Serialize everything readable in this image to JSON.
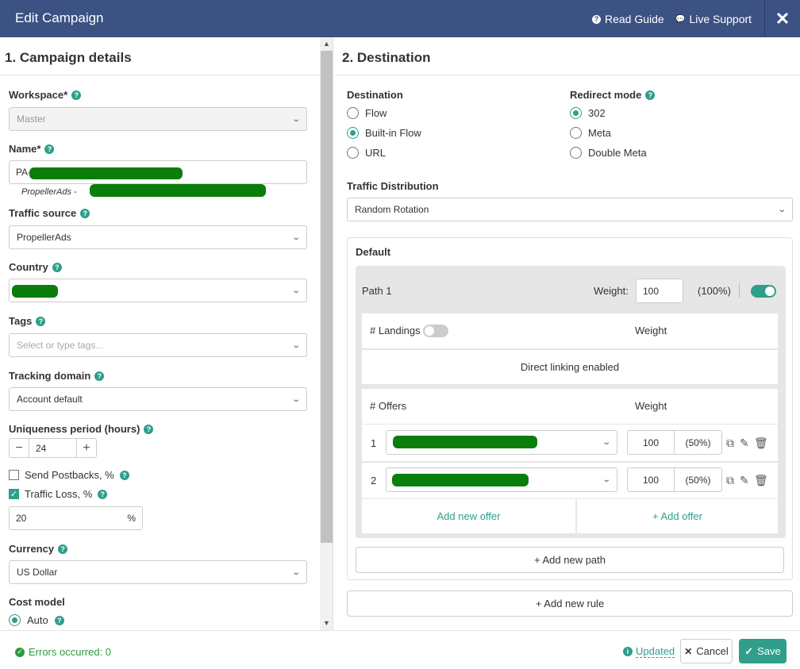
{
  "header": {
    "title": "Edit Campaign",
    "read_guide": "Read Guide",
    "live_support": "Live Support",
    "close": "✕"
  },
  "left": {
    "section_title": "1. Campaign details",
    "workspace": {
      "label": "Workspace*",
      "value": "Master"
    },
    "name": {
      "label": "Name*",
      "value": "PA-",
      "sub": "PropellerAds -"
    },
    "traffic_source": {
      "label": "Traffic source",
      "value": "PropellerAds"
    },
    "country": {
      "label": "Country",
      "value": ""
    },
    "tags": {
      "label": "Tags",
      "placeholder": "Select or type tags..."
    },
    "tracking_domain": {
      "label": "Tracking domain",
      "value": "Account default"
    },
    "uniqueness": {
      "label": "Uniqueness period (hours)",
      "value": "24",
      "minus": "−",
      "plus": "+"
    },
    "send_postbacks": {
      "label": "Send Postbacks, %",
      "checked": false
    },
    "traffic_loss": {
      "label": "Traffic Loss, %",
      "checked": true,
      "value": "20",
      "unit": "%"
    },
    "currency": {
      "label": "Currency",
      "value": "US Dollar"
    },
    "cost_model": {
      "label": "Cost model",
      "option": "Auto"
    }
  },
  "right": {
    "section_title": "2. Destination",
    "destination": {
      "label": "Destination",
      "options": [
        "Flow",
        "Built-in Flow",
        "URL"
      ],
      "selected": "Built-in Flow"
    },
    "redirect": {
      "label": "Redirect mode",
      "options": [
        "302",
        "Meta",
        "Double Meta"
      ],
      "selected": "302"
    },
    "traffic_distribution": {
      "label": "Traffic Distribution",
      "value": "Random Rotation"
    },
    "rule": {
      "name": "Default",
      "path": {
        "name": "Path 1",
        "weight_label": "Weight:",
        "weight": "100",
        "percent": "(100%)",
        "enabled": true
      },
      "landings": {
        "label": "# Landings",
        "weight_header": "Weight",
        "direct": "Direct linking enabled"
      },
      "offers": {
        "label": "# Offers",
        "weight_header": "Weight",
        "rows": [
          {
            "num": "1",
            "weight": "100",
            "percent": "(50%)"
          },
          {
            "num": "2",
            "weight": "100",
            "percent": "(50%)"
          }
        ],
        "add_new_offer": "Add new offer",
        "add_offer": "+ Add offer"
      },
      "add_new_path": "+ Add new path"
    },
    "add_new_rule": "+ Add new rule"
  },
  "footer": {
    "errors": "Errors occurred: 0",
    "updated": "Updated",
    "cancel": "Cancel",
    "save": "Save"
  },
  "colors": {
    "header": "#3b5283",
    "accent": "#2f9e8a",
    "redaction": "#0a7e0a"
  }
}
